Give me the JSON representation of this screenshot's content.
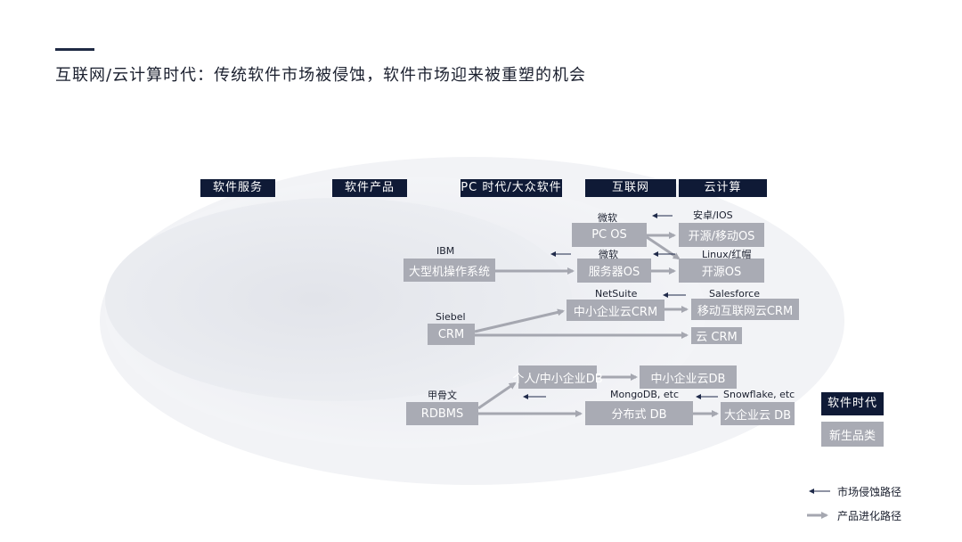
{
  "title": "互联网/云计算时代：传统软件市场被侵蚀，软件市场迎来被重塑的机会",
  "colors": {
    "navy": "#0f1a36",
    "box": "#a9abb4",
    "arrow_gray": "#a5a7b0",
    "arrow_dark": "#1f2a4a"
  },
  "headers": {
    "software_service": "软件服务",
    "software_product": "软件产品",
    "pc_era": "PC 时代/大众软件",
    "internet": "互联网",
    "cloud": "云计算"
  },
  "nodes": {
    "mainframe_os": "大型机操作系统",
    "crm": "CRM",
    "rdbms": "RDBMS",
    "pc_os": "PC OS",
    "server_os": "服务器OS",
    "smb_cloud_crm": "中小企业云CRM",
    "personal_smb_db": "个人/中小企业DB",
    "distributed_db": "分布式 DB",
    "opensource_mobile_os": "开源/移动OS",
    "opensource_os": "开源OS",
    "mobile_internet_crm": "移动互联网云CRM",
    "cloud_crm": "云 CRM",
    "smb_cloud_db": "中小企业云DB",
    "enterprise_cloud_db": "大企业云 DB"
  },
  "labels": {
    "ibm": "IBM",
    "siebel": "Siebel",
    "oracle": "甲骨文",
    "microsoft_1": "微软",
    "microsoft_2": "微软",
    "netsuite": "NetSuite",
    "mongodb": "MongoDB, etc",
    "android_ios": "安卓/IOS",
    "linux_redhat": "Linux/红帽",
    "salesforce": "Salesforce",
    "snowflake": "Snowflake, etc"
  },
  "legend": {
    "software_era": "软件时代",
    "new_category": "新生品类",
    "erosion_path": "市场侵蚀路径",
    "evolution_path": "产品进化路径"
  }
}
